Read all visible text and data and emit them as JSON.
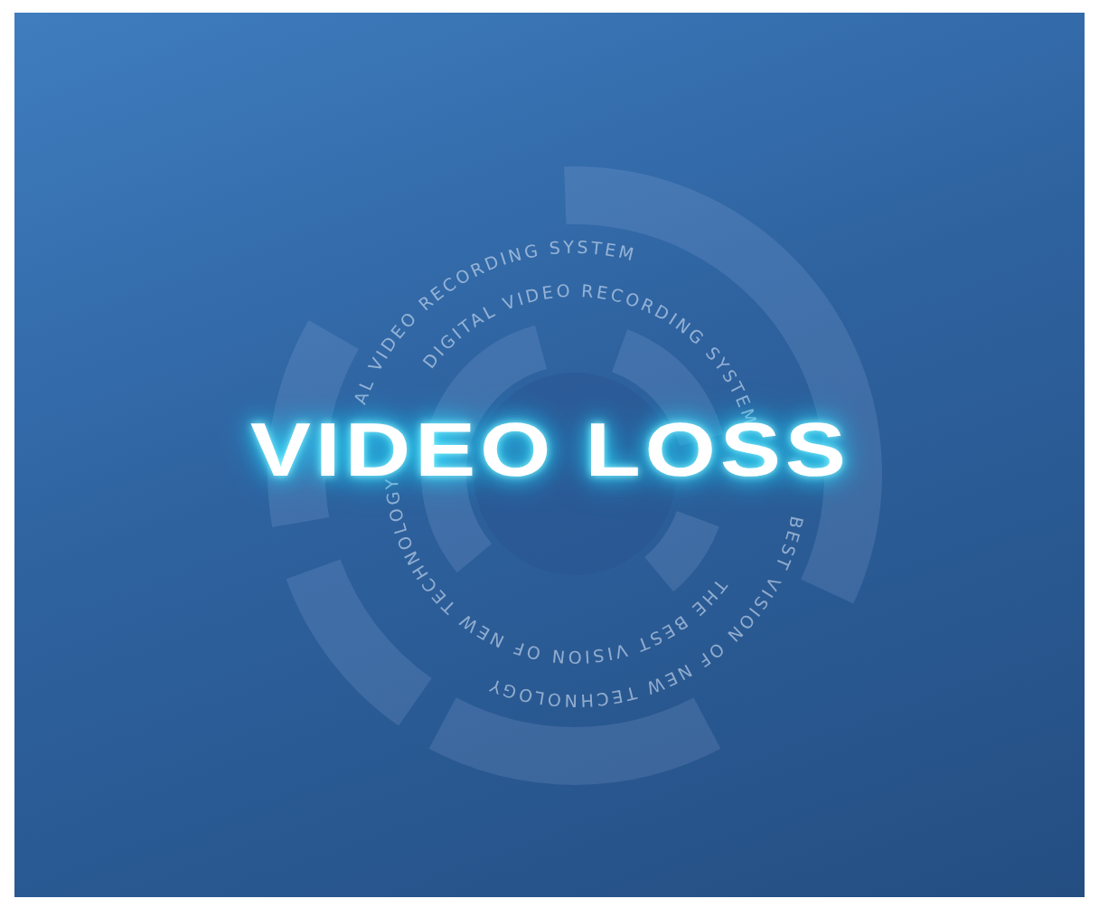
{
  "title": "VIDEO LOSS",
  "ring_texts": [
    {
      "text": "AL VIDEO RECORDING SYSTEM"
    },
    {
      "text": "DIGITAL VIDEO RECORDING SYSTEM"
    },
    {
      "text": "BEST VISION OF NEW TECHNOLOGY"
    },
    {
      "text": "THE BEST VISION OF NEW TECHNOLOGY"
    }
  ]
}
